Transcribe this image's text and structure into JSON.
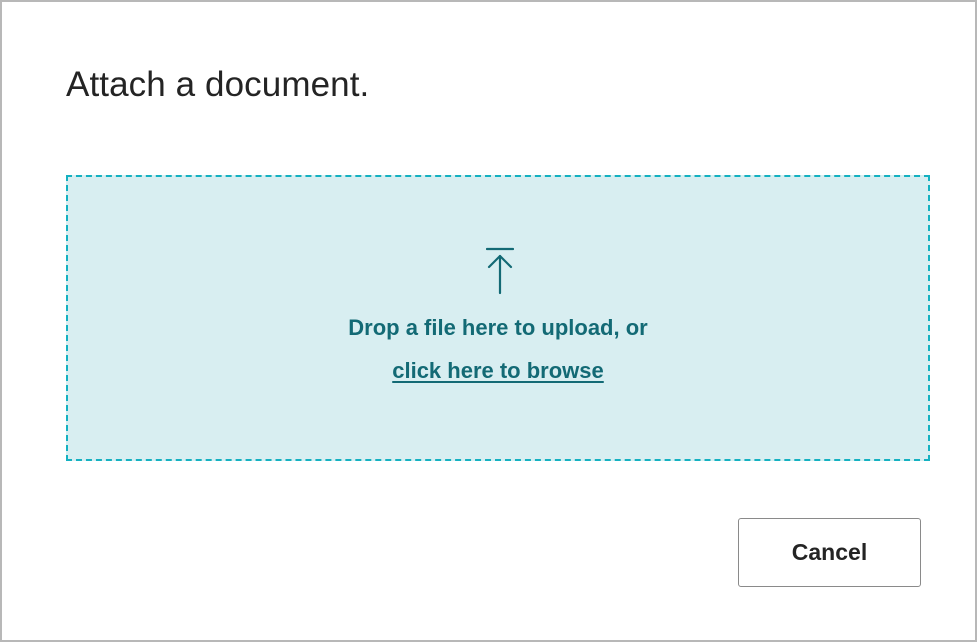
{
  "dialog": {
    "title": "Attach a document.",
    "drop_zone": {
      "icon": "upload-arrow-icon",
      "instruction": "Drop a file here to upload, or",
      "browse_link": "click here to browse"
    },
    "cancel_label": "Cancel"
  },
  "colors": {
    "drop_zone_background": "#d8eef1",
    "drop_zone_border": "#14b1c1",
    "accent_text": "#136a75",
    "title_text": "#242424"
  }
}
